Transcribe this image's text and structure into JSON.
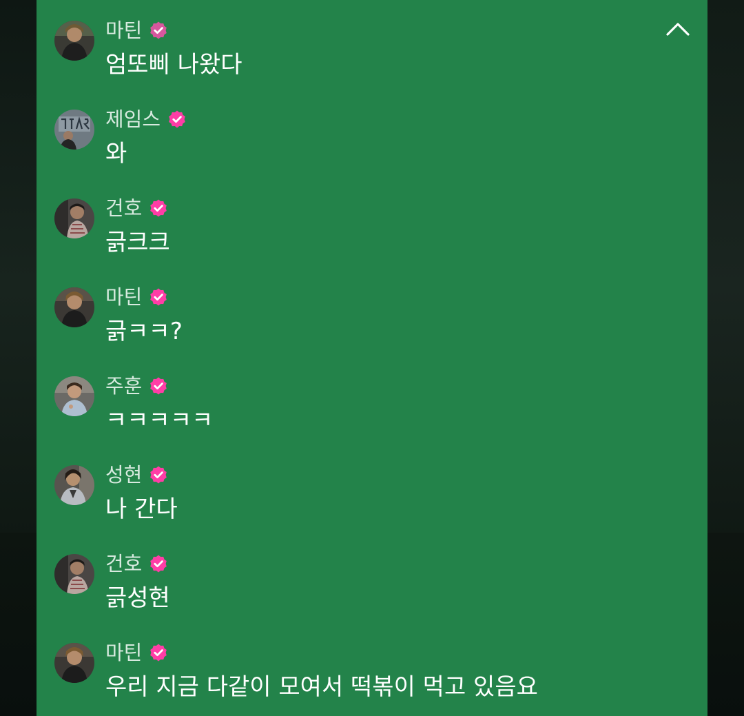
{
  "colors": {
    "panel_bg": "#23834a",
    "badge": "#ff3da6",
    "name_text": "#d7eadf",
    "message_text": "#ffffff"
  },
  "icons": {
    "collapse": "chevron-up-icon",
    "verified": "verified-badge-icon"
  },
  "messages": [
    {
      "name": "마틴",
      "text": "엄또삐 나왔다"
    },
    {
      "name": "제임스",
      "text": "와"
    },
    {
      "name": "건호",
      "text": "긁크크"
    },
    {
      "name": "마틴",
      "text": "긁ㅋㅋ?"
    },
    {
      "name": "주훈",
      "text": "ㅋㅋㅋㅋㅋ"
    },
    {
      "name": "성현",
      "text": "나 간다"
    },
    {
      "name": "건호",
      "text": "긁성현"
    },
    {
      "name": "마틴",
      "text": "우리 지금 다같이 모여서 떡볶이 먹고 있음요"
    }
  ]
}
